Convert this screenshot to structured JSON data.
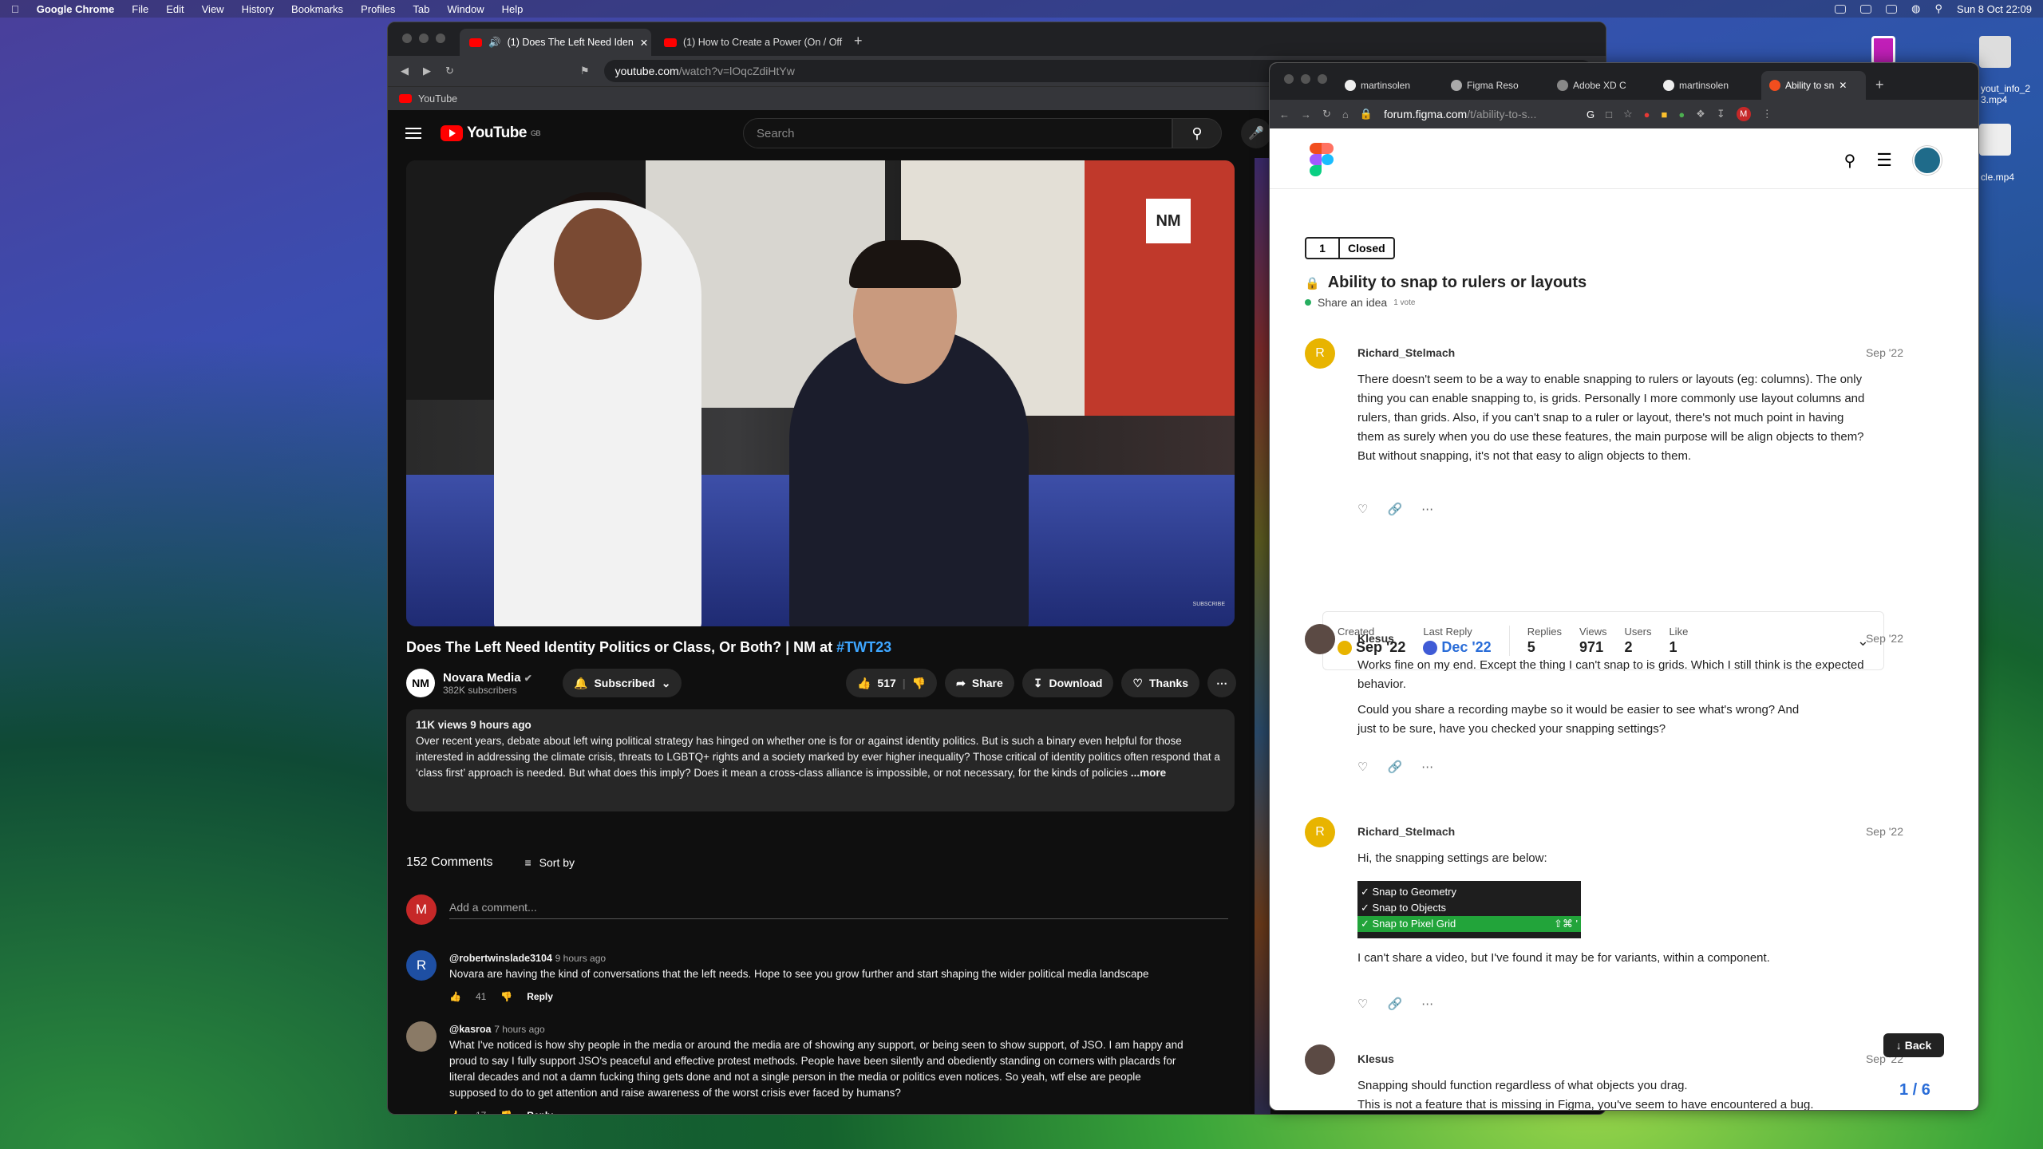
{
  "menubar": {
    "app": "Google Chrome",
    "items": [
      "File",
      "Edit",
      "View",
      "History",
      "Bookmarks",
      "Profiles",
      "Tab",
      "Window",
      "Help"
    ],
    "datetime": "Sun 8 Oct  22:09"
  },
  "desktop": {
    "file1": "yout_info_2\n3.mp4",
    "file2": "cle.mp4"
  },
  "yt_window": {
    "tabs": [
      {
        "label": "(1) Does The Left Need Iden"
      },
      {
        "label": "(1) How to Create a Power (On / Off"
      }
    ],
    "url_host": "youtube.com",
    "url_path": "/watch?v=lOqcZdiHtYw",
    "bookmark": "YouTube",
    "logo_text": "YouTube",
    "logo_region": "GB",
    "search_placeholder": "Search",
    "video_overlay": "SUBSCRIBE",
    "video_logo": "NM",
    "title_main": "Does The Left Need Identity Politics or Class, Or Both? | NM at ",
    "title_tag": "#TWT23",
    "channel": {
      "name": "Novara Media",
      "subs": "382K subscribers",
      "avatar": "NM"
    },
    "buttons": {
      "subscribed": "Subscribed",
      "likes": "517",
      "share": "Share",
      "download": "Download",
      "thanks": "Thanks"
    },
    "desc": {
      "stats": "11K views  9 hours ago",
      "text": "Over recent years, debate about left wing political strategy has hinged on whether one is for or against identity politics. But is such a binary even helpful for those interested in addressing the climate crisis, threats to LGBTQ+ rights and a society marked by ever higher inequality? Those critical of identity politics often respond that a ‘class first’ approach is needed. But what does this imply? Does it mean a cross-class alliance is impossible, or not necessary, for the kinds of policies",
      "more": "...more"
    },
    "comments_count": "152 Comments",
    "sort_by": "Sort by",
    "add_comment": "Add a comment...",
    "my_initial": "M",
    "comments": [
      {
        "initial": "R",
        "author": "@robertwinslade3104",
        "time": "9 hours ago",
        "text": "Novara are having the kind of conversations that the left needs. Hope to see you grow further and start shaping the wider political media landscape",
        "likes": "41",
        "reply": "Reply"
      },
      {
        "initial": "",
        "author": "@kasroa",
        "time": "7 hours ago",
        "text": "What I've noticed is how shy people in the media or around the media are of showing any support, or being seen to show support, of JSO. I am happy and proud to say I fully support JSO's peaceful and effective protest methods. People have been silently and obediently standing on corners with placards for literal decades and not a damn fucking thing gets done and not a single person in the media or politics even notices. So yeah, wtf else are people supposed to do to get attention and raise awareness of the worst crisis ever faced by humans?",
        "likes": "17",
        "reply": "Reply"
      }
    ]
  },
  "figma_window": {
    "tabs": [
      "martinsolen",
      "Figma Reso",
      "Adobe XD C",
      "martinsolen",
      "Ability to sn"
    ],
    "url_host": "forum.figma.com",
    "url_path": "/t/ability-to-s...",
    "vote_count": "1",
    "vote_status": "Closed",
    "title": "Ability to snap to rulers or layouts",
    "category": "Share an idea",
    "votes_small": "1 vote",
    "posts": [
      {
        "initial": "R",
        "name": "Richard_Stelmach",
        "date": "Sep '22",
        "text": "There doesn't seem to be a way to enable snapping to rulers or layouts (eg: columns). The only thing you can enable snapping to, is grids. Personally I more commonly use layout columns and rulers, than grids. Also, if you can't snap to a ruler or layout, there's not much point in having them as surely when you do use these features, the main purpose will be align objects to them? But without snapping, it's not that easy to align objects to them."
      },
      {
        "initial": "",
        "name": "Klesus",
        "date": "Sep '22",
        "text": "Works fine on my end. Except the thing I can't snap to is grids. Which I still think is the expected behavior.",
        "text2": "Could you share a recording maybe so it would be easier to see what's wrong? And just to be sure, have you checked your snapping settings?"
      },
      {
        "initial": "R",
        "name": "Richard_Stelmach",
        "date": "Sep '22",
        "text": "Hi, the snapping settings are below:",
        "text2": "I can't share a video, but I've found it may be for variants, within a component."
      },
      {
        "initial": "",
        "name": "Klesus",
        "date": "Sep '22",
        "text": "Snapping should function regardless of what objects you drag.",
        "text2": "This is not a feature that is missing in Figma, you've seem to have encountered a bug."
      }
    ],
    "meta": {
      "created_label": "Created",
      "created": "Sep '22",
      "last_label": "Last Reply",
      "last": "Dec '22",
      "replies_label": "Replies",
      "replies": "5",
      "views_label": "Views",
      "views": "971",
      "users_label": "Users",
      "users": "2",
      "like_label": "Like",
      "like": "1"
    },
    "snap_menu": [
      "✓ Snap to Geometry",
      "✓ Snap to Objects",
      "✓ Snap to Pixel Grid"
    ],
    "snap_shortcut": "⇧⌘ '",
    "back": "Back",
    "pager": "1 / 6"
  }
}
